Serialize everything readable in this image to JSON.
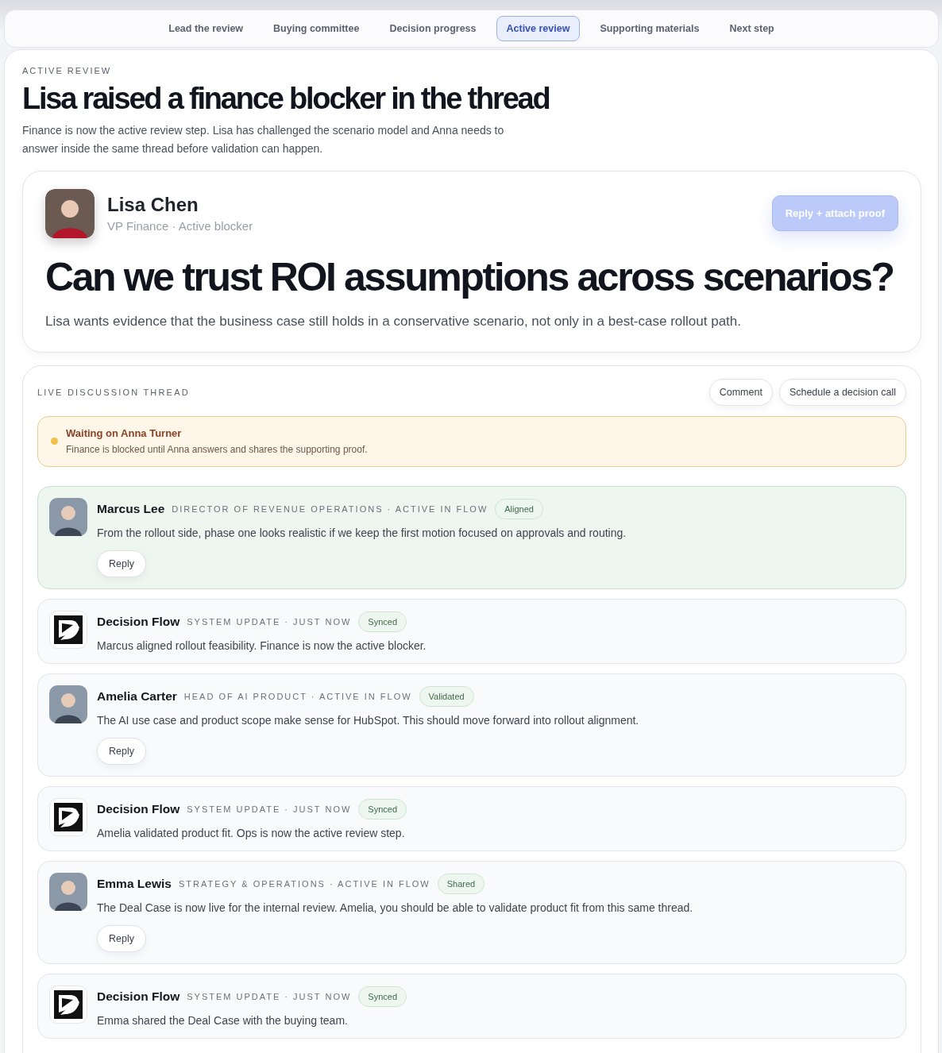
{
  "tabs": [
    {
      "label": "Lead the review",
      "selected": false
    },
    {
      "label": "Buying committee",
      "selected": false
    },
    {
      "label": "Decision progress",
      "selected": false
    },
    {
      "label": "Active review",
      "selected": true
    },
    {
      "label": "Supporting materials",
      "selected": false
    },
    {
      "label": "Next step",
      "selected": false
    }
  ],
  "eyebrow": "ACTIVE REVIEW",
  "title": "Lisa raised a finance blocker in the thread",
  "intro": "Finance is now the active review step. Lisa has challenged the scenario model and Anna needs to answer inside the same thread before validation can happen.",
  "blocker": {
    "name": "Lisa Chen",
    "role": "VP Finance · Active blocker",
    "action": "Reply + attach proof",
    "question": "Can we trust ROI assumptions across scenarios?",
    "detail": "Lisa wants evidence that the business case still holds in a conservative scenario, not only in a best-case rollout path."
  },
  "thread": {
    "label": "LIVE DISCUSSION THREAD",
    "actions": [
      "Comment",
      "Schedule a decision call"
    ],
    "notice": {
      "title": "Waiting on Anna Turner",
      "text": "Finance is blocked until Anna answers and shares the supporting proof.",
      "color": "#f0c24a"
    },
    "messages": [
      {
        "kind": "person",
        "name": "Marcus Lee",
        "meta": "DIRECTOR OF REVENUE OPERATIONS · ACTIVE IN FLOW",
        "tag": "Aligned",
        "text": "From the rollout side, phase one looks realistic if we keep the first motion focused on approvals and routing.",
        "reply": "Reply",
        "highlighted": true
      },
      {
        "kind": "system",
        "name": "Decision Flow",
        "meta": "SYSTEM UPDATE · JUST NOW",
        "tag": "Synced",
        "text": "Marcus aligned rollout feasibility. Finance is now the active blocker.",
        "highlighted": false
      },
      {
        "kind": "person",
        "name": "Amelia Carter",
        "meta": "HEAD OF AI PRODUCT · ACTIVE IN FLOW",
        "tag": "Validated",
        "text": "The AI use case and product scope make sense for HubSpot. This should move forward into rollout alignment.",
        "reply": "Reply",
        "highlighted": false
      },
      {
        "kind": "system",
        "name": "Decision Flow",
        "meta": "SYSTEM UPDATE · JUST NOW",
        "tag": "Synced",
        "text": "Amelia validated product fit. Ops is now the active review step.",
        "highlighted": false
      },
      {
        "kind": "person",
        "name": "Emma Lewis",
        "meta": "STRATEGY & OPERATIONS · ACTIVE IN FLOW",
        "tag": "Shared",
        "text": "The Deal Case is now live for the internal review. Amelia, you should be able to validate product fit from this same thread.",
        "reply": "Reply",
        "highlighted": false
      },
      {
        "kind": "system",
        "name": "Decision Flow",
        "meta": "SYSTEM UPDATE · JUST NOW",
        "tag": "Synced",
        "text": "Emma shared the Deal Case with the buying team.",
        "highlighted": false
      }
    ]
  }
}
